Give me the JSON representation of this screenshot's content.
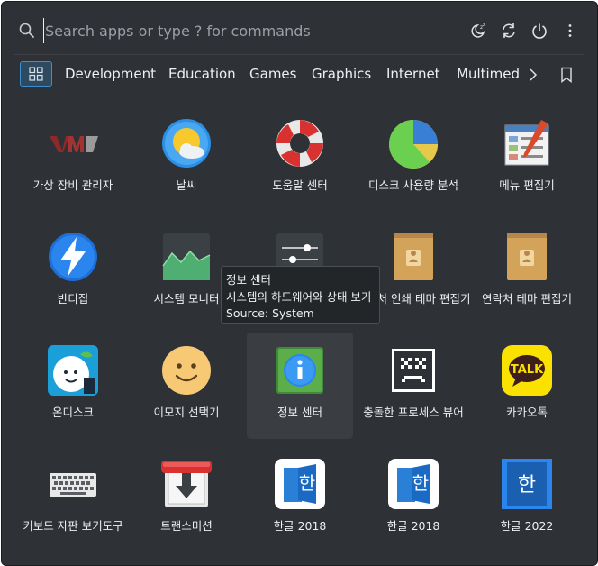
{
  "search": {
    "placeholder": "Search apps or type ? for commands"
  },
  "toolbar": {
    "sleep_icon": "sleep-icon",
    "restart_icon": "restart-icon",
    "power_icon": "power-icon",
    "more_icon": "more-vertical-icon"
  },
  "categories": {
    "items": [
      {
        "label": "Development"
      },
      {
        "label": "Education"
      },
      {
        "label": "Games"
      },
      {
        "label": "Graphics"
      },
      {
        "label": "Internet"
      },
      {
        "label": "Multimedia"
      }
    ]
  },
  "apps": [
    {
      "label": "가상 장비 관리자"
    },
    {
      "label": "날씨"
    },
    {
      "label": "도움말 센터"
    },
    {
      "label": "디스크 사용량 분석"
    },
    {
      "label": "메뉴 편집기"
    },
    {
      "label": "반디집"
    },
    {
      "label": "시스템 모니터"
    },
    {
      "label": ""
    },
    {
      "label": "연락처 인쇄 테마 편집기"
    },
    {
      "label": "연락처 테마 편집기"
    },
    {
      "label": "온디스크"
    },
    {
      "label": "이모지 선택기"
    },
    {
      "label": "정보 센터"
    },
    {
      "label": "충돌한 프로세스 뷰어"
    },
    {
      "label": "카카오톡"
    },
    {
      "label": "키보드 자판 보기도구"
    },
    {
      "label": "트랜스미션"
    },
    {
      "label": "한글 2018"
    },
    {
      "label": "한글 2018"
    },
    {
      "label": "한글 2022"
    }
  ],
  "tooltip": {
    "title": "정보 센터",
    "description": "시스템의 하드웨어와 상태 보기",
    "source": "Source: System"
  },
  "colors": {
    "accent": "#3d8dcf",
    "background": "#2e3135"
  }
}
